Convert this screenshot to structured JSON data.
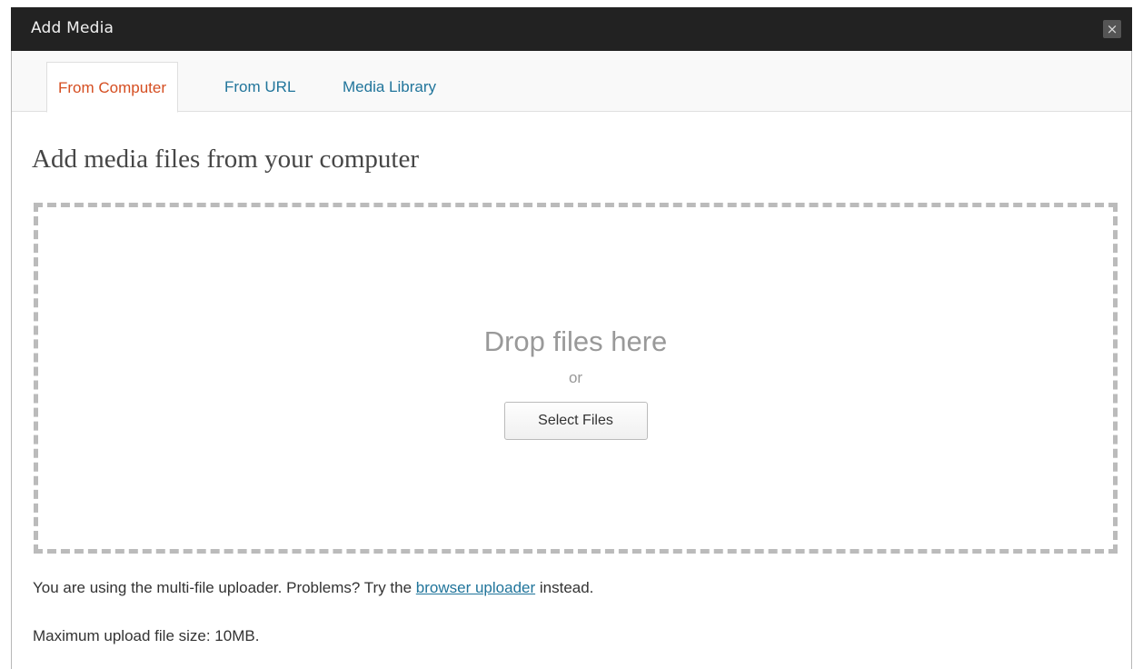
{
  "dialog": {
    "title": "Add Media",
    "close_icon": "close-icon",
    "close_glyph": "×"
  },
  "tabs": [
    {
      "label": "From Computer",
      "active": true
    },
    {
      "label": "From URL",
      "active": false
    },
    {
      "label": "Media Library",
      "active": false
    }
  ],
  "main": {
    "heading": "Add media files from your computer",
    "dropzone": {
      "drop_text": "Drop files here",
      "or_text": "or",
      "select_button": "Select Files"
    },
    "uploader_note": {
      "prefix": "You are using the multi-file uploader. Problems? Try the ",
      "link": "browser uploader",
      "suffix": " instead."
    },
    "max_size": "Maximum upload file size: 10MB."
  },
  "colors": {
    "titlebar": "#222222",
    "link": "#21759b",
    "active_tab": "#d54e21",
    "dropzone_border": "#bbbbbb"
  }
}
